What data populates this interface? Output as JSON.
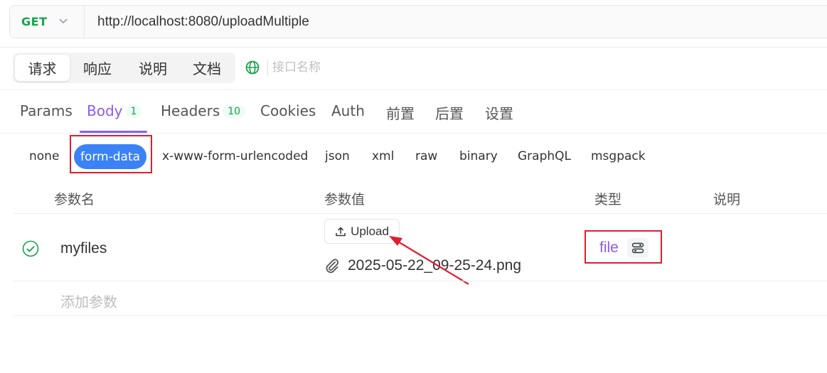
{
  "request": {
    "method": "GET",
    "url": "http://localhost:8080/uploadMultiple"
  },
  "top_tabs": [
    {
      "label": "请求",
      "active": true
    },
    {
      "label": "响应",
      "active": false
    },
    {
      "label": "说明",
      "active": false
    },
    {
      "label": "文档",
      "active": false
    }
  ],
  "api_name_placeholder": "接口名称",
  "sub_tabs": [
    {
      "label": "Params"
    },
    {
      "label": "Body",
      "badge": "1",
      "active": true
    },
    {
      "label": "Headers",
      "badge": "10"
    },
    {
      "label": "Cookies"
    },
    {
      "label": "Auth"
    },
    {
      "label": "前置"
    },
    {
      "label": "后置"
    },
    {
      "label": "设置"
    }
  ],
  "body_types": [
    "none",
    "form-data",
    "x-www-form-urlencoded",
    "json",
    "xml",
    "raw",
    "binary",
    "GraphQL",
    "msgpack"
  ],
  "selected_body_type": "form-data",
  "table": {
    "headers": [
      "参数名",
      "参数值",
      "类型",
      "说明"
    ],
    "rows": [
      {
        "enabled": true,
        "name": "myfiles",
        "upload_label": "Upload",
        "file_name": "2025-05-22_09-25-24.png",
        "type": "file"
      }
    ],
    "add_placeholder": "添加参数"
  },
  "colors": {
    "accent": "#8b5cf6",
    "method_get": "#16a34a",
    "selected_pill": "#3b82f6",
    "annotation_red": "#e11d2e"
  }
}
